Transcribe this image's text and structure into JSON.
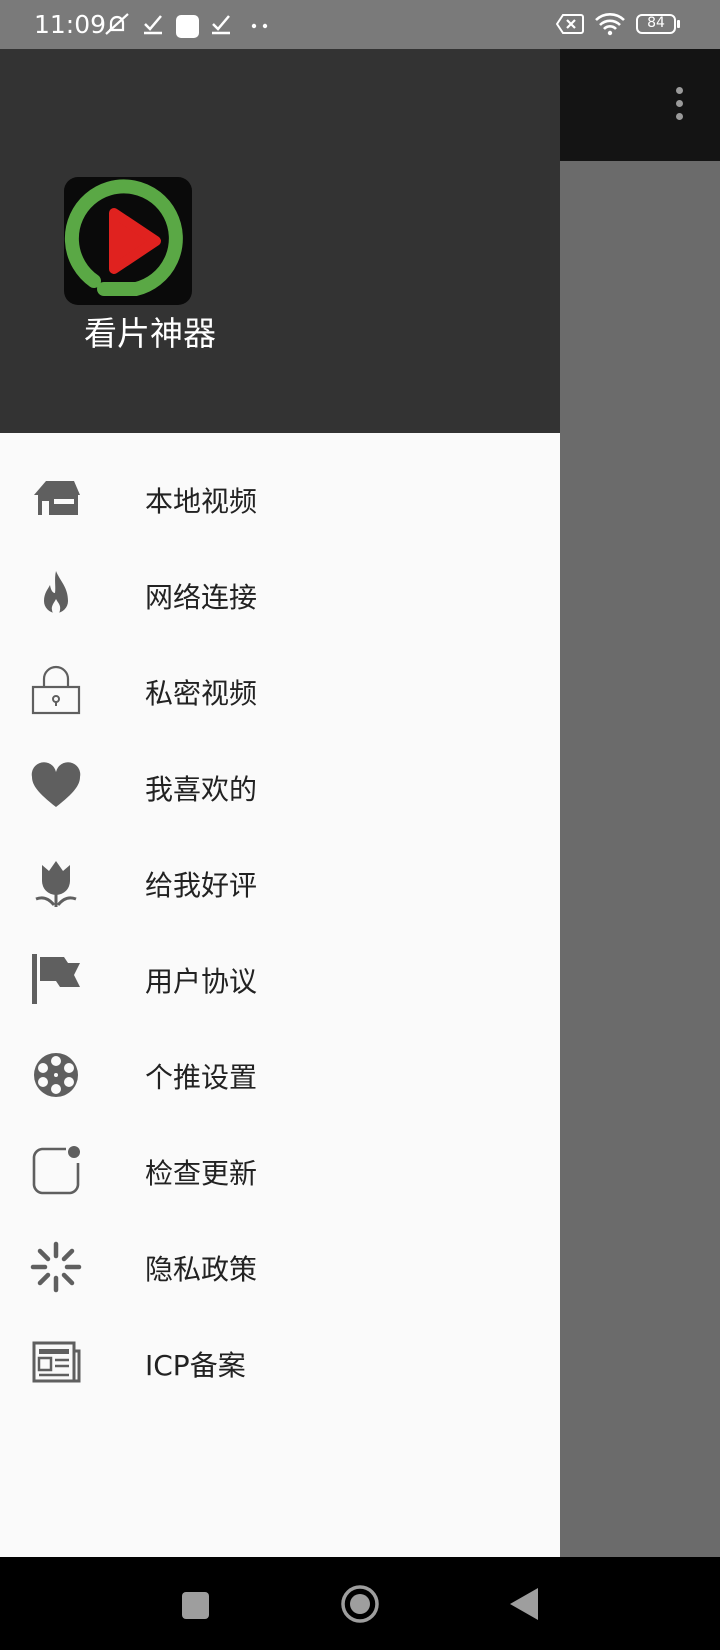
{
  "status_bar": {
    "time": "11:09",
    "battery": "84",
    "icons": [
      "mute-bell-icon",
      "check-icon",
      "square-icon",
      "check-icon",
      "more-dots-icon",
      "sim-x-icon",
      "wifi-icon",
      "battery-icon"
    ]
  },
  "toolbar": {
    "overflow_icon": "more-vert-icon"
  },
  "drawer": {
    "app_name": "看片神器",
    "logo_icon": "play-logo-icon",
    "items": [
      {
        "label": "本地视频",
        "icon": "house-icon"
      },
      {
        "label": "网络连接",
        "icon": "fire-icon"
      },
      {
        "label": "私密视频",
        "icon": "lock-icon"
      },
      {
        "label": "我喜欢的",
        "icon": "heart-icon"
      },
      {
        "label": "给我好评",
        "icon": "tulip-icon"
      },
      {
        "label": "用户协议",
        "icon": "flag-icon"
      },
      {
        "label": "个推设置",
        "icon": "film-reel-icon"
      },
      {
        "label": "检查更新",
        "icon": "notification-badge-icon"
      },
      {
        "label": "隐私政策",
        "icon": "spinner-icon"
      },
      {
        "label": "ICP备案",
        "icon": "newspaper-icon"
      }
    ]
  },
  "nav_bar": {
    "recents_icon": "square-icon",
    "home_icon": "circle-icon",
    "back_icon": "triangle-back-icon"
  },
  "colors": {
    "header_bg": "#333333",
    "drawer_bg": "#fafafa",
    "icon_gray": "#5f5f5f",
    "logo_green": "#5aa845",
    "logo_red": "#e0221f"
  }
}
